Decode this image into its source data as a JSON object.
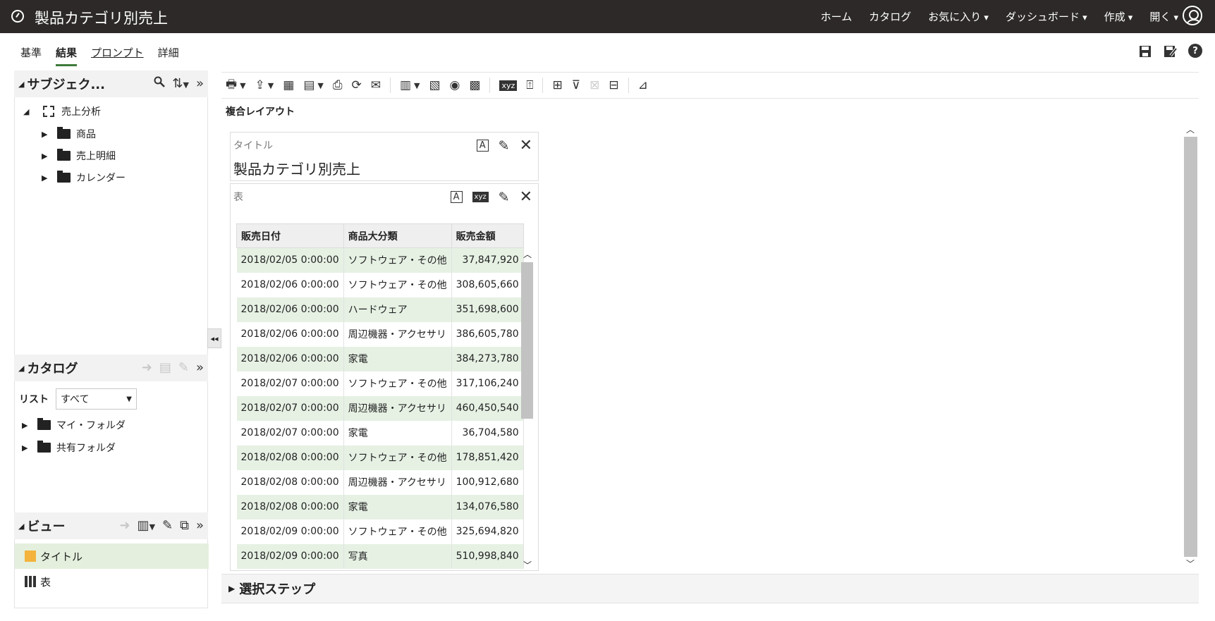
{
  "app": {
    "title": "製品カテゴリ別売上",
    "nav": [
      {
        "label": "ホーム",
        "caret": false
      },
      {
        "label": "カタログ",
        "caret": false
      },
      {
        "label": "お気に入り",
        "caret": true
      },
      {
        "label": "ダッシュボード",
        "caret": true
      },
      {
        "label": "作成",
        "caret": true
      },
      {
        "label": "開く",
        "caret": true
      }
    ]
  },
  "tabs": [
    {
      "label": "基準"
    },
    {
      "label": "結果"
    },
    {
      "label": "プロンプト"
    },
    {
      "label": "詳細"
    }
  ],
  "subject_panel": {
    "title": "サブジェク...",
    "root": "売上分析",
    "folders": [
      "商品",
      "売上明細",
      "カレンダー"
    ]
  },
  "catalog_panel": {
    "title": "カタログ",
    "list_label": "リスト",
    "list_value": "すべて",
    "folders": [
      "マイ・フォルダ",
      "共有フォルダ"
    ]
  },
  "views_panel": {
    "title": "ビュー",
    "items": [
      "タイトル",
      "表"
    ]
  },
  "compound_layout_label": "複合レイアウト",
  "title_view": {
    "label": "タイトル",
    "text": "製品カテゴリ別売上"
  },
  "table_view": {
    "label": "表",
    "columns": [
      "販売日付",
      "商品大分類",
      "販売金額"
    ],
    "rows": [
      [
        "2018/02/05 0:00:00",
        "ソフトウェア・その他",
        "37,847,920"
      ],
      [
        "2018/02/06 0:00:00",
        "ソフトウェア・その他",
        "308,605,660"
      ],
      [
        "2018/02/06 0:00:00",
        "ハードウェア",
        "351,698,600"
      ],
      [
        "2018/02/06 0:00:00",
        "周辺機器・アクセサリ",
        "386,605,780"
      ],
      [
        "2018/02/06 0:00:00",
        "家電",
        "384,273,780"
      ],
      [
        "2018/02/07 0:00:00",
        "ソフトウェア・その他",
        "317,106,240"
      ],
      [
        "2018/02/07 0:00:00",
        "周辺機器・アクセサリ",
        "460,450,540"
      ],
      [
        "2018/02/07 0:00:00",
        "家電",
        "36,704,580"
      ],
      [
        "2018/02/08 0:00:00",
        "ソフトウェア・その他",
        "178,851,420"
      ],
      [
        "2018/02/08 0:00:00",
        "周辺機器・アクセサリ",
        "100,912,680"
      ],
      [
        "2018/02/08 0:00:00",
        "家電",
        "134,076,580"
      ],
      [
        "2018/02/09 0:00:00",
        "ソフトウェア・その他",
        "325,694,820"
      ],
      [
        "2018/02/09 0:00:00",
        "写真",
        "510,998,840"
      ]
    ]
  },
  "selection_steps": "選択ステップ"
}
